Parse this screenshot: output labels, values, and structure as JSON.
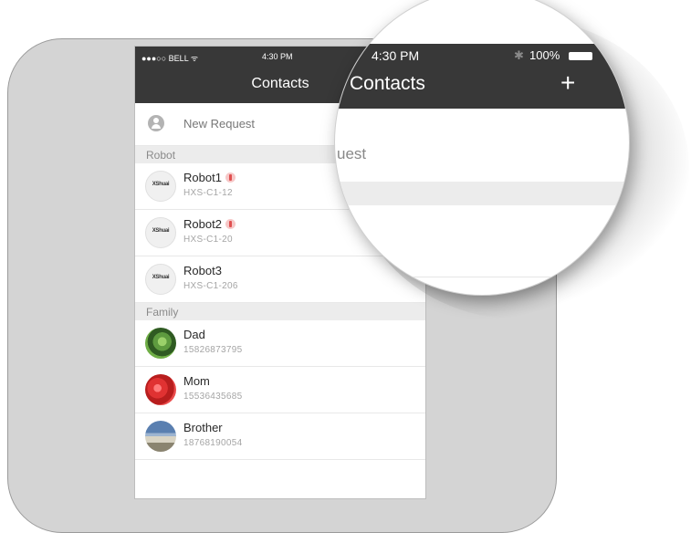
{
  "status_bar": {
    "carrier": "●●●○○ BELL ᯤ",
    "time": "4:30 PM"
  },
  "nav": {
    "title": "Contacts"
  },
  "new_request": {
    "label": "New Request"
  },
  "sections": [
    {
      "title": "Robot",
      "contacts": [
        {
          "name": "Robot1",
          "id": "HXS-C1-12",
          "logo": "XShuai",
          "alert": true
        },
        {
          "name": "Robot2",
          "id": "HXS-C1-20",
          "logo": "XShuai",
          "alert": true
        },
        {
          "name": "Robot3",
          "id": "HXS-C1-206",
          "logo": "XShuai",
          "alert": false
        }
      ]
    },
    {
      "title": "Family",
      "contacts": [
        {
          "name": "Dad",
          "id": "15826873795"
        },
        {
          "name": "Mom",
          "id": "15536435685"
        },
        {
          "name": "Brother",
          "id": "18768190054"
        }
      ]
    }
  ],
  "magnifier": {
    "time": "4:30 PM",
    "bluetooth": "✱",
    "battery": "100%",
    "title": "Contacts",
    "add": "+",
    "request_fragment": "uest"
  },
  "colors": {
    "nav_bg": "#383838",
    "section_bg": "#ececec",
    "alert": "#e05050"
  }
}
